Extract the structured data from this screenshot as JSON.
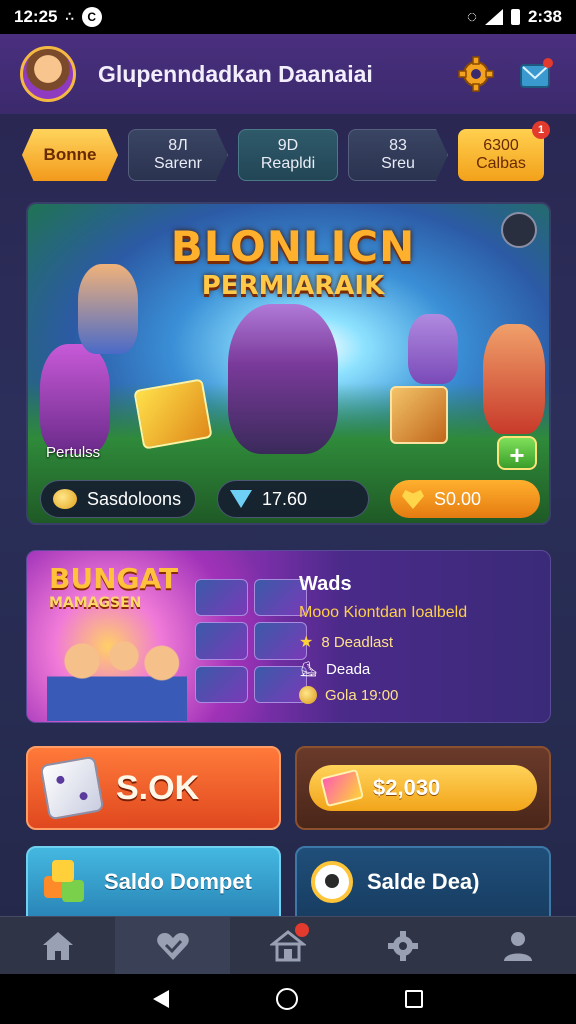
{
  "status_bar": {
    "time": "12:25",
    "right_time": "2:38"
  },
  "header": {
    "title": "Glupenndadkan Daanaiai"
  },
  "tabs": [
    {
      "line1": "Bonne",
      "line2": ""
    },
    {
      "line1": "8Л",
      "line2": "Sarenr"
    },
    {
      "line1": "9D",
      "line2": "Reapldi"
    },
    {
      "line1": "83",
      "line2": "Sreu"
    },
    {
      "line1": "6300",
      "line2": "Calbas",
      "badge": "1"
    }
  ],
  "hero": {
    "title_line1": "BLONLICN",
    "title_line2": "PERMIARAIK",
    "label": "Pertulss",
    "pill_left": "Sasdoloons",
    "pill_mid": "17.60",
    "pill_right": "S0.00",
    "plus_label": "+"
  },
  "promo": {
    "art_title": "BUNGAT",
    "art_subtitle": "MAMAGSEN",
    "title": "Wads",
    "desc": "Mooo Kiontdan Ioalbeld",
    "row1": "8 Deadlast",
    "row2": "Deada",
    "row3": "Gola 19:00"
  },
  "actions": {
    "a_label": "S.OK",
    "b_label": "$2,030",
    "c_label": "Saldo Dompet",
    "d_label": "Salde Dea)"
  },
  "colors": {
    "accent": "#f5a623",
    "brand": "#4a2f7f"
  }
}
